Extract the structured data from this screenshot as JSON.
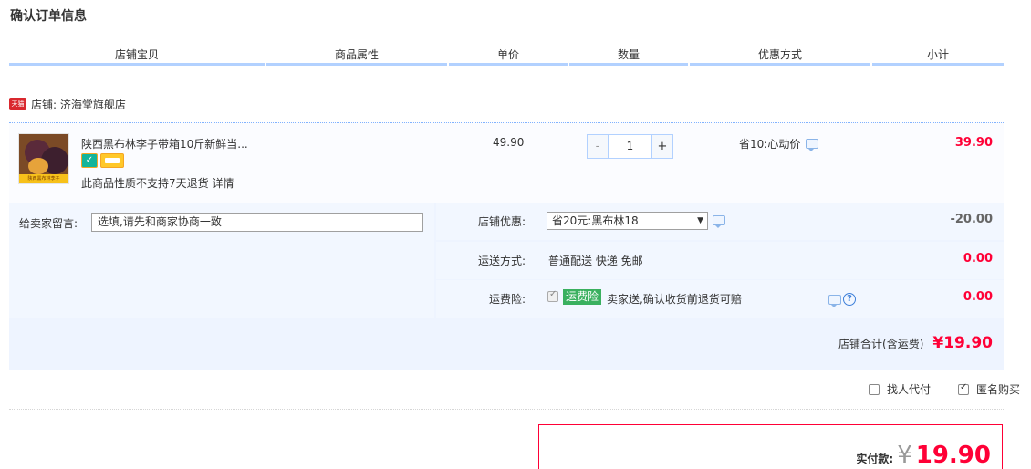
{
  "page": {
    "title": "确认订单信息"
  },
  "columns": [
    "店铺宝贝",
    "商品属性",
    "单价",
    "数量",
    "优惠方式",
    "小计"
  ],
  "shop": {
    "label": "店铺: 济海堂旗舰店",
    "badge": "天猫"
  },
  "item": {
    "title": "陕西黑布林李子带箱10斤新鲜当...",
    "thumb_caption": "陕西黑布林李子",
    "return_note": "此商品性质不支持7天退货  详情",
    "unit_price": "49.90",
    "qty_minus": "-",
    "qty_value": "1",
    "qty_plus": "+",
    "promo": "省10:心动价",
    "subtotal": "39.90",
    "svc_icon1": "✓"
  },
  "message": {
    "label": "给卖家留言:",
    "placeholder": "选填,请先和商家协商一致"
  },
  "options": {
    "discount": {
      "label": "店铺优惠:",
      "value": "省20元:黑布林18",
      "arrow": "▼",
      "amount": "-20.00"
    },
    "shipping": {
      "label": "运送方式:",
      "value": "普通配送 快递 免邮",
      "amount": "0.00"
    },
    "insurance": {
      "label": "运费险:",
      "badge": "运费险",
      "text": "卖家送,确认收货前退货可赔",
      "help": "?",
      "amount": "0.00"
    }
  },
  "shop_total": {
    "label": "店铺合计(含运费)",
    "value": "¥19.90"
  },
  "payment": {
    "proxy": "找人代付",
    "anonymous": "匿名购买"
  },
  "final": {
    "label": "实付款:",
    "yen": "¥",
    "value": "19.90"
  },
  "colors": {
    "accent": "#ff0036",
    "border_blue": "#b2d1ff",
    "badge_green": "#3ab05f"
  }
}
